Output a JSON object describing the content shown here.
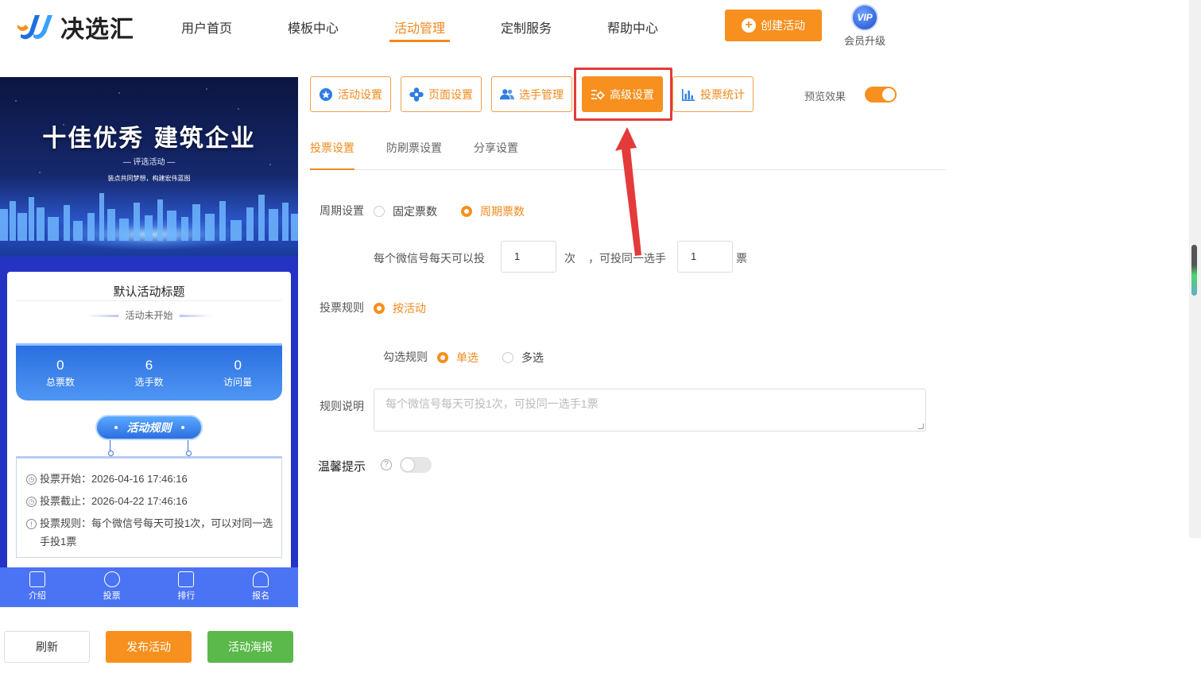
{
  "logo": {
    "text": "决选汇"
  },
  "nav": {
    "items": [
      "用户首页",
      "模板中心",
      "活动管理",
      "定制服务",
      "帮助中心"
    ],
    "active_index": 2,
    "create_label": "创建活动",
    "vip_badge": "VIP",
    "vip_label": "会员升级"
  },
  "colors": {
    "accent": "#f7901e",
    "highlight": "#e43a3a",
    "phone_bg": "#2433c4",
    "green": "#5ab94a"
  },
  "preview": {
    "banner_title": "十佳优秀 建筑企业",
    "banner_sub": "— 评选活动 —",
    "banner_sub2": "装点共同梦想，构建宏伟蓝图",
    "card_title": "默认活动标题",
    "card_status": "活动未开始",
    "stats": [
      {
        "value": "0",
        "label": "总票数"
      },
      {
        "value": "6",
        "label": "选手数"
      },
      {
        "value": "0",
        "label": "访问量"
      }
    ],
    "rules_pill": "活动规则",
    "rules": [
      {
        "icon": "clock-icon",
        "text": "投票开始：2026-04-16 17:46:16"
      },
      {
        "icon": "clock-icon",
        "text": "投票截止：2026-04-22 17:46:16"
      },
      {
        "icon": "info-icon",
        "text": "投票规则：每个微信号每天可投1次，可以对同一选手投1票"
      }
    ],
    "tabs": [
      {
        "icon": "document-icon",
        "label": "介绍"
      },
      {
        "icon": "vote-icon",
        "label": "投票"
      },
      {
        "icon": "chart-icon",
        "label": "排行"
      },
      {
        "icon": "user-icon",
        "label": "报名"
      }
    ]
  },
  "left_buttons": {
    "refresh": "刷新",
    "publish": "发布活动",
    "poster": "活动海报"
  },
  "toolbar": {
    "buttons": [
      {
        "icon": "star-badge-icon",
        "label": "活动设置"
      },
      {
        "icon": "gear-flower-icon",
        "label": "页面设置"
      },
      {
        "icon": "users-icon",
        "label": "选手管理"
      },
      {
        "icon": "settings-sliders-icon",
        "label": "高级设置"
      },
      {
        "icon": "bar-chart-icon",
        "label": "投票统计"
      }
    ],
    "active_index": 3,
    "preview_label": "预览效果",
    "preview_on": true
  },
  "subtabs": {
    "items": [
      "投票设置",
      "防刷票设置",
      "分享设置"
    ],
    "active_index": 0
  },
  "form": {
    "period_label": "周期设置",
    "period_options": [
      "固定票数",
      "周期票数"
    ],
    "period_selected": 1,
    "daily_prefix": "每个微信号每天可以投",
    "daily_value": "1",
    "daily_unit": "次",
    "same_prefix": "，可投同一选手",
    "same_value": "1",
    "same_unit": "票",
    "rule_label": "投票规则",
    "rule_option": "按活动",
    "check_label": "勾选规则",
    "check_options": [
      "单选",
      "多选"
    ],
    "check_selected": 0,
    "desc_label": "规则说明",
    "desc_placeholder": "每个微信号每天可投1次，可投同一选手1票",
    "tip_label": "温馨提示",
    "tip_on": false
  }
}
